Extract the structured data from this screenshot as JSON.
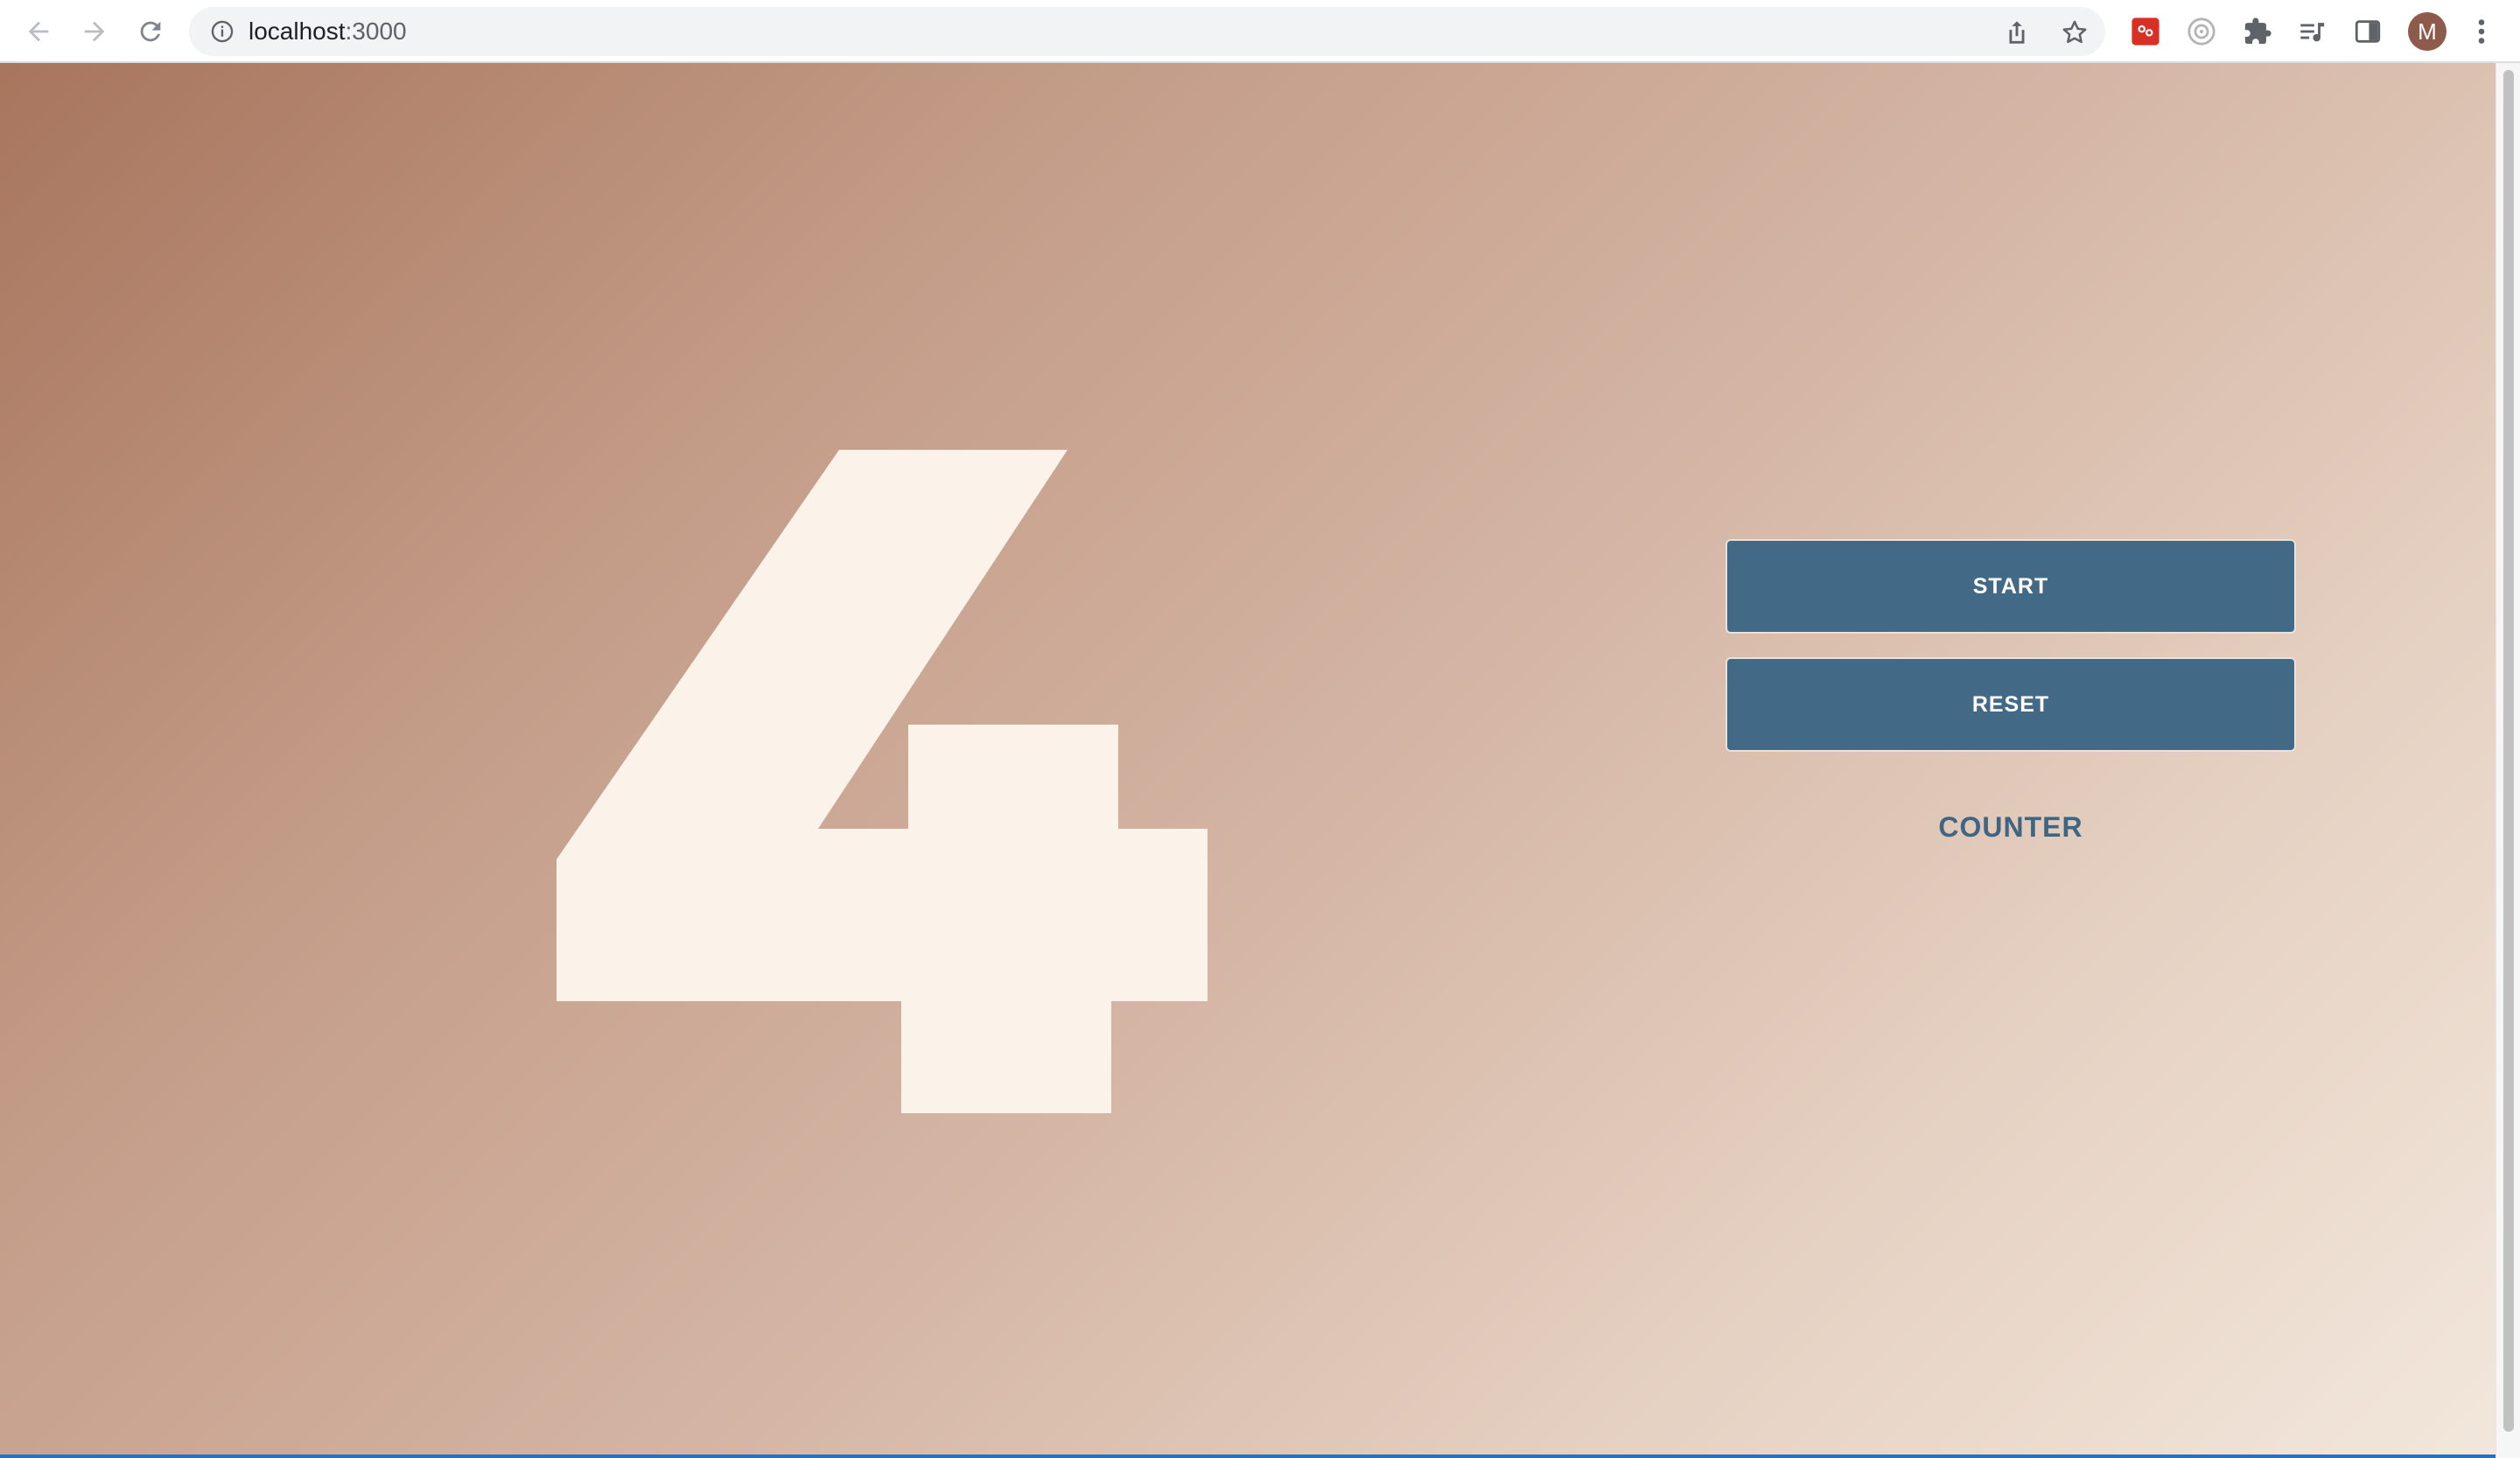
{
  "browser": {
    "url_host": "localhost",
    "url_port": ":3000",
    "avatar_initial": "M",
    "icons": {
      "back": "arrow-left-icon",
      "forward": "arrow-right-icon",
      "reload": "reload-icon",
      "info": "info-icon",
      "share": "share-icon",
      "bookmark": "star-icon",
      "extension_1": "extension-red-icon",
      "extension_2": "extension-gray-icon",
      "extensions_menu": "puzzle-icon",
      "media": "media-queue-icon",
      "side_panel": "side-panel-icon",
      "menu": "more-vertical-icon"
    }
  },
  "app": {
    "count": 4,
    "start_label": "START",
    "reset_label": "RESET",
    "counter_label": "COUNTER"
  },
  "colors": {
    "button_bg": "#426985",
    "digit_fill": "#fbf3ea",
    "accent_text": "#3f6583",
    "gradient_start": "#a8755d",
    "gradient_end": "#f2e7dc"
  }
}
